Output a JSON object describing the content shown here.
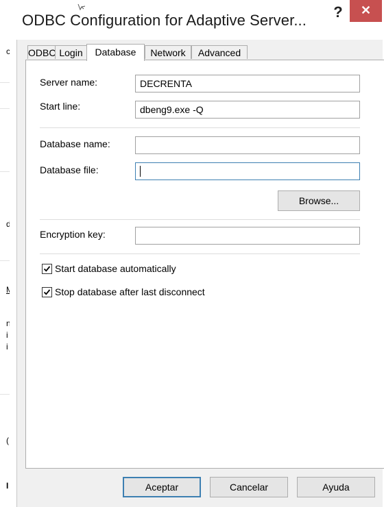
{
  "window": {
    "title": "ODBC Configuration for Adaptive Server...",
    "help_glyph": "?",
    "close_glyph": "✕",
    "close_color": "#c75050"
  },
  "background_fragments": [
    "c",
    "d",
    "M",
    "n",
    "i",
    "i",
    "(",
    "I"
  ],
  "tabs": [
    {
      "label": "ODBC",
      "active": false
    },
    {
      "label": "Login",
      "active": false
    },
    {
      "label": "Database",
      "active": true
    },
    {
      "label": "Network",
      "active": false
    },
    {
      "label": "Advanced",
      "active": false
    }
  ],
  "form": {
    "server_name": {
      "label": "Server name:",
      "value": "DECRENTA"
    },
    "start_line": {
      "label": "Start line:",
      "value": "dbeng9.exe -Q"
    },
    "database_name": {
      "label": "Database name:",
      "value": ""
    },
    "database_file": {
      "label": "Database file:",
      "value": ""
    },
    "browse_label": "Browse...",
    "encryption_key": {
      "label": "Encryption key:",
      "value": ""
    },
    "start_automatically": {
      "label": "Start database automatically",
      "checked": true
    },
    "stop_after_disconnect": {
      "label": "Stop database after last disconnect",
      "checked": true
    }
  },
  "buttons": {
    "ok": "Aceptar",
    "cancel": "Cancelar",
    "help": "Ayuda"
  },
  "colors": {
    "focus_border": "#3c7fb1",
    "dialog_bg": "#f0f0f0"
  }
}
